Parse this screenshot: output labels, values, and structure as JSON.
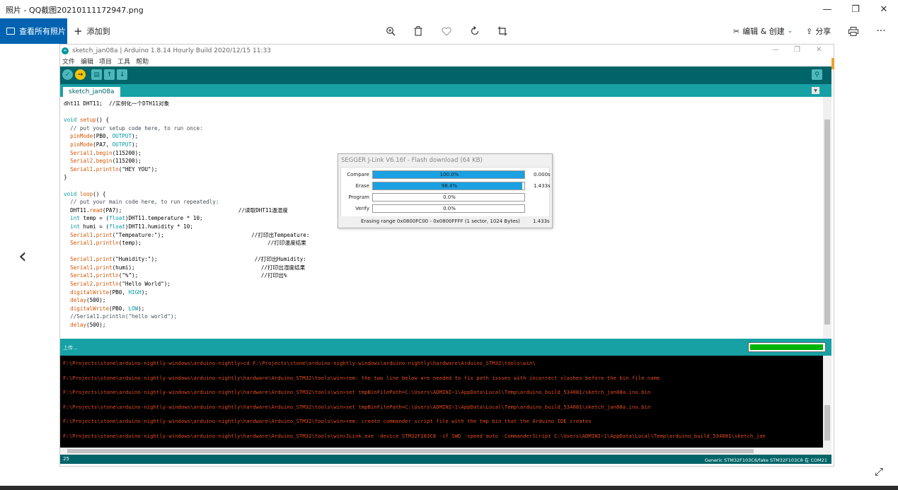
{
  "window": {
    "title": "照片 - QQ截图20210111172947.png",
    "minimize": "—",
    "restore": "❐",
    "close": "✕"
  },
  "toolbar": {
    "view_all": "查看所有照片",
    "add_to": "添加到",
    "edit_create": "编辑 & 创建",
    "share": "分享"
  },
  "arduino": {
    "title": "sketch_jan08a | Arduino 1.8.14 Hourly Build 2020/12/15 11:33",
    "menu": [
      "文件",
      "编辑",
      "项目",
      "工具",
      "帮助"
    ],
    "tab": "sketch_jan08a",
    "code_lines": [
      [
        [
          "dht11 DHT11;  //实例化一个DTH11对象",
          ""
        ]
      ],
      [
        [
          "",
          ""
        ]
      ],
      [
        [
          "void",
          "t"
        ],
        [
          " ",
          ""
        ],
        [
          "setup",
          "f"
        ],
        [
          "() {",
          ""
        ]
      ],
      [
        [
          "  // put your setup code here, to run once:",
          "c"
        ]
      ],
      [
        [
          "  ",
          ""
        ],
        [
          "pinMode",
          "f"
        ],
        [
          "(PB0, ",
          ""
        ],
        [
          "OUTPUT",
          "o"
        ],
        [
          ");",
          ""
        ]
      ],
      [
        [
          "  ",
          ""
        ],
        [
          "pinMode",
          "f"
        ],
        [
          "(PA7, ",
          ""
        ],
        [
          "OUTPUT",
          "o"
        ],
        [
          ");",
          ""
        ]
      ],
      [
        [
          "  ",
          ""
        ],
        [
          "Serial1",
          "f"
        ],
        [
          ".",
          ""
        ],
        [
          "begin",
          "f"
        ],
        [
          "(115200);",
          ""
        ]
      ],
      [
        [
          "  ",
          ""
        ],
        [
          "Serial2",
          "f"
        ],
        [
          ".",
          ""
        ],
        [
          "begin",
          "f"
        ],
        [
          "(115200);",
          ""
        ]
      ],
      [
        [
          "  ",
          ""
        ],
        [
          "Serial1",
          "f"
        ],
        [
          ".",
          ""
        ],
        [
          "println",
          "f"
        ],
        [
          "(\"HEY YOU\");",
          ""
        ]
      ],
      [
        [
          "}",
          ""
        ]
      ],
      [
        [
          "",
          ""
        ]
      ],
      [
        [
          "void",
          "t"
        ],
        [
          " ",
          ""
        ],
        [
          "loop",
          "f"
        ],
        [
          "() {",
          ""
        ]
      ],
      [
        [
          "  // put your main code here, to run repeatedly:",
          "c"
        ]
      ],
      [
        [
          "  DHT11.",
          ""
        ],
        [
          "read",
          "f"
        ],
        [
          "(PA7);                                    //读取DHT11温湿度",
          ""
        ]
      ],
      [
        [
          "  ",
          ""
        ],
        [
          "int",
          "t"
        ],
        [
          " temp = (",
          ""
        ],
        [
          "float",
          "t"
        ],
        [
          ")DHT11.temperature * 10;",
          ""
        ]
      ],
      [
        [
          "  ",
          ""
        ],
        [
          "int",
          "t"
        ],
        [
          " humi = (",
          ""
        ],
        [
          "float",
          "t"
        ],
        [
          ")DHT11.humidity * 10;",
          ""
        ]
      ],
      [
        [
          "  ",
          ""
        ],
        [
          "Serial1",
          "f"
        ],
        [
          ".",
          ""
        ],
        [
          "print",
          "f"
        ],
        [
          "(\"Tempeature:\");                           //打印出Tempeature:",
          ""
        ]
      ],
      [
        [
          "  ",
          ""
        ],
        [
          "Serial1",
          "f"
        ],
        [
          ".",
          ""
        ],
        [
          "println",
          "f"
        ],
        [
          "(temp);                                       //打印温度结果",
          ""
        ]
      ],
      [
        [
          "",
          ""
        ]
      ],
      [
        [
          "  ",
          ""
        ],
        [
          "Serial1",
          "f"
        ],
        [
          ".",
          ""
        ],
        [
          "print",
          "f"
        ],
        [
          "(\"Humidity:\");                              //打印出Humidity:",
          ""
        ]
      ],
      [
        [
          "  ",
          ""
        ],
        [
          "Serial1",
          "f"
        ],
        [
          ".",
          ""
        ],
        [
          "print",
          "f"
        ],
        [
          "(humi);                                       //打印出湿度结果",
          ""
        ]
      ],
      [
        [
          "  ",
          ""
        ],
        [
          "Serial1",
          "f"
        ],
        [
          ".",
          ""
        ],
        [
          "println",
          "f"
        ],
        [
          "(\"%\");                                      //打印出%",
          ""
        ]
      ],
      [
        [
          "  ",
          ""
        ],
        [
          "Serial2",
          "f"
        ],
        [
          ".",
          ""
        ],
        [
          "println",
          "f"
        ],
        [
          "(\"Hello World\");",
          ""
        ]
      ],
      [
        [
          "  ",
          ""
        ],
        [
          "digitalWrite",
          "f"
        ],
        [
          "(PB0, ",
          ""
        ],
        [
          "HIGH",
          "o"
        ],
        [
          ");",
          ""
        ]
      ],
      [
        [
          "  ",
          ""
        ],
        [
          "delay",
          "f"
        ],
        [
          "(500);",
          ""
        ]
      ],
      [
        [
          "  ",
          ""
        ],
        [
          "digitalWrite",
          "f"
        ],
        [
          "(PB0, ",
          ""
        ],
        [
          "LOW",
          "o"
        ],
        [
          ");",
          ""
        ]
      ],
      [
        [
          "  //Serial1.println(\"hello world\");",
          "c"
        ]
      ],
      [
        [
          "  ",
          ""
        ],
        [
          "delay",
          "f"
        ],
        [
          "(500);",
          ""
        ]
      ]
    ],
    "status": "上传...",
    "upload_progress": 0.97,
    "console_lines": [
      "F:\\Projects\\stone\\arduino-nightly-windows\\arduino-nightly>cd F:\\Projects\\stone\\arduino-nightly-windows\\arduino-nightly\\hardware\\Arduino_STM32\\tools\\win\\",
      "F:\\Projects\\stone\\arduino-nightly-windows\\arduino-nightly\\hardware\\Arduino_STM32\\tools\\win>rem: the two line below are needed to fix path issues with incorrect slashes before the bin file name",
      "F:\\Projects\\stone\\arduino-nightly-windows\\arduino-nightly\\hardware\\Arduino_STM32\\tools\\win>set tmpBinFilePath=C:\\Users\\ADMINI~1\\AppData\\Local\\Temp\\arduino_build_534081/sketch_jan08a.ino.bin",
      "F:\\Projects\\stone\\arduino-nightly-windows\\arduino-nightly\\hardware\\Arduino_STM32\\tools\\win>set tmpBinFilePath=C:\\Users\\ADMINI~1\\AppData\\Local\\Temp\\arduino_build_534081\\sketch_jan08a.ino.bin",
      "F:\\Projects\\stone\\arduino-nightly-windows\\arduino-nightly\\hardware\\Arduino_STM32\\tools\\win>rem: create commander script file with the tmp bin that the Arduino IDE creates",
      "F:\\Projects\\stone\\arduino-nightly-windows\\arduino-nightly\\hardware\\Arduino_STM32\\tools\\win>JLink.exe -device STM32F103C8 -if SWD -speed auto -CommanderScript C:\\Users\\ADMINI~1\\AppData\\Local\\Temp\\arduino_build_534081\\sketch_jan"
    ],
    "line_number": "25",
    "board_info": "Generic STM32F103C6/fake STM32F103C8 在 COM21"
  },
  "jlink": {
    "title": "SEGGER J-Link V6.16f - Flash download (64 KB)",
    "rows": [
      {
        "label": "Compare",
        "percent_text": "100.0%",
        "progress": 1.0,
        "time": "0.000s"
      },
      {
        "label": "Erase",
        "percent_text": "98.4%",
        "progress": 0.984,
        "time": "1.433s"
      },
      {
        "label": "Program",
        "percent_text": "0.0%",
        "progress": 0.0,
        "time": ""
      },
      {
        "label": "Verify",
        "percent_text": "0.0%",
        "progress": 0.0,
        "time": ""
      }
    ],
    "footer_text": "Erasing range 0x0800FC00 - 0x0800FFFF (1 sector, 1024 Bytes)",
    "footer_time": "1.433s"
  },
  "colors": {
    "accent": "#0063b1",
    "arduino_teal": "#006468",
    "arduino_light": "#17a1a5",
    "console_text": "#e34c22",
    "jlink_bar": "#1ba1e2"
  }
}
